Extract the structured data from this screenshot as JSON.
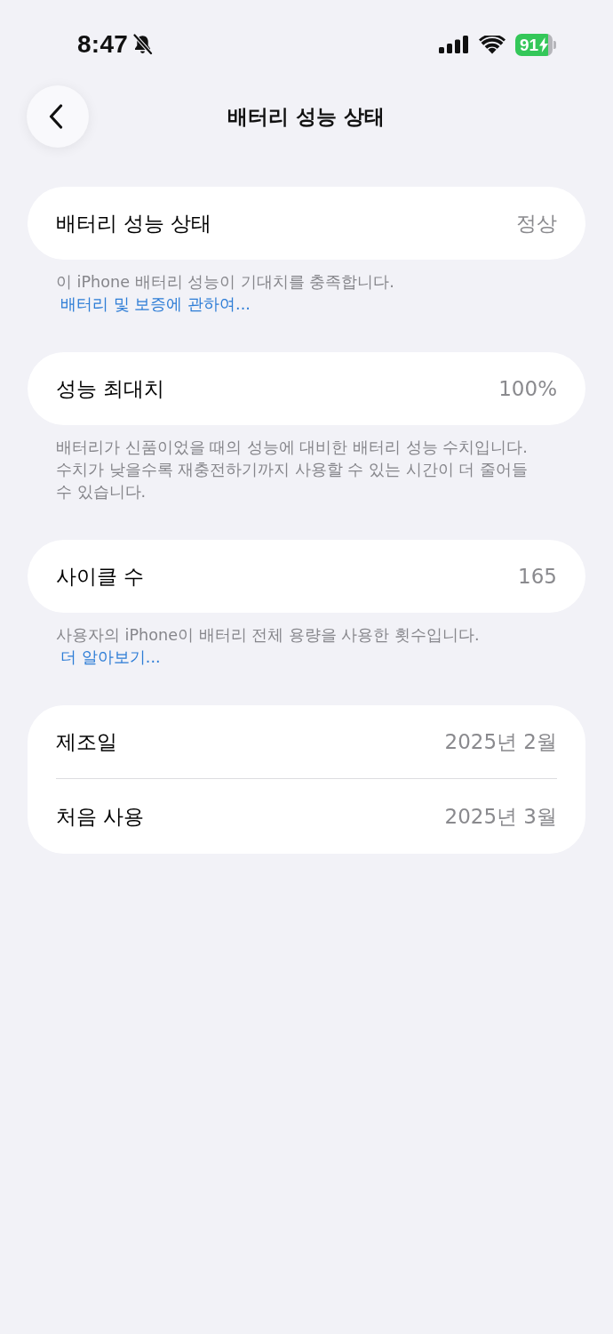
{
  "status_bar": {
    "time": "8:47",
    "battery": "91",
    "charging": true
  },
  "nav": {
    "title": "배터리 성능 상태"
  },
  "sections": [
    {
      "rows": [
        {
          "label": "배터리 성능 상태",
          "value": "정상"
        }
      ],
      "footer": {
        "text": "이 iPhone 배터리 성능이 기대치를 충족합니다.",
        "link": "배터리 및 보증에 관하여..."
      }
    },
    {
      "rows": [
        {
          "label": "성능 최대치",
          "value": "100%"
        }
      ],
      "footer": {
        "text": "배터리가 신품이었을 때의 성능에 대비한 배터리 성능 수치입니다. 수치가 낮을수록 재충전하기까지 사용할 수 있는 시간이 더 줄어들 수 있습니다."
      }
    },
    {
      "rows": [
        {
          "label": "사이클 수",
          "value": "165"
        }
      ],
      "footer": {
        "text": "사용자의 iPhone이 배터리 전체 용량을 사용한 횟수입니다.",
        "link": "더 알아보기..."
      }
    },
    {
      "rows": [
        {
          "label": "제조일",
          "value": "2025년 2월"
        },
        {
          "label": "처음 사용",
          "value": "2025년 3월"
        }
      ]
    }
  ]
}
